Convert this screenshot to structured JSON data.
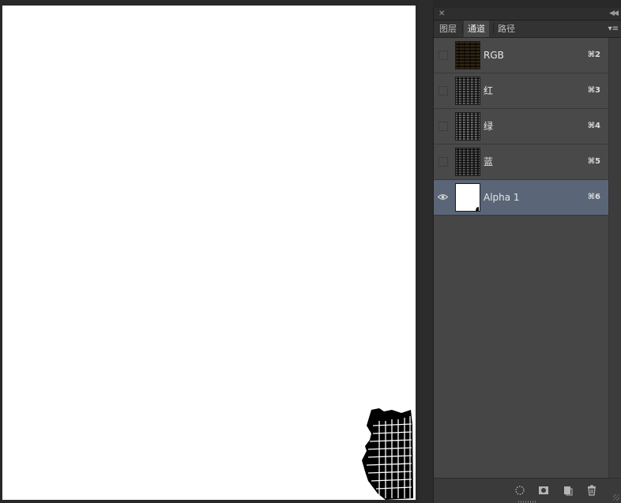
{
  "panel": {
    "tabs": [
      {
        "label": "图层",
        "active": false
      },
      {
        "label": "通道",
        "active": true
      },
      {
        "label": "路径",
        "active": false
      }
    ]
  },
  "channels": [
    {
      "name": "RGB",
      "shortcut": "⌘2",
      "visible": false,
      "selected": false,
      "thumb": "color"
    },
    {
      "name": "红",
      "shortcut": "⌘3",
      "visible": false,
      "selected": false,
      "thumb": "gray"
    },
    {
      "name": "绿",
      "shortcut": "⌘4",
      "visible": false,
      "selected": false,
      "thumb": "gray"
    },
    {
      "name": "蓝",
      "shortcut": "⌘5",
      "visible": false,
      "selected": false,
      "thumb": "gray"
    },
    {
      "name": "Alpha 1",
      "shortcut": "⌘6",
      "visible": true,
      "selected": true,
      "thumb": "white"
    }
  ],
  "footer": {
    "buttons": [
      "load-selection-icon",
      "save-selection-icon",
      "new-channel-icon",
      "trash-icon"
    ]
  },
  "colors": {
    "selected_row": "#5a6577",
    "panel_bg": "#464646",
    "canvas": "#ffffff"
  }
}
